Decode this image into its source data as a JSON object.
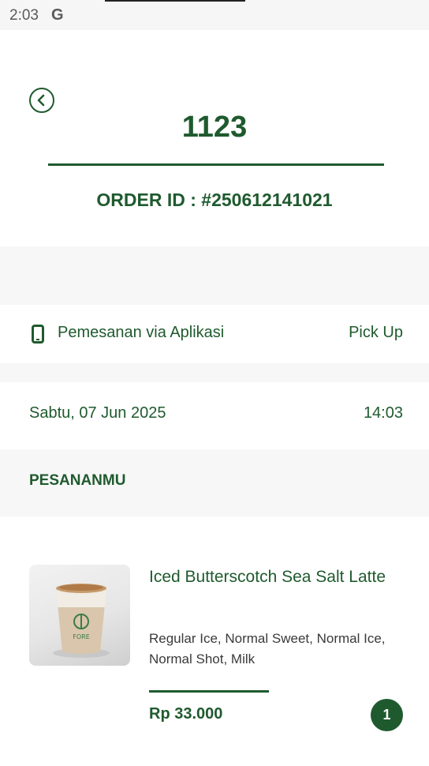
{
  "status_bar": {
    "time": "2:03",
    "google_icon": "G"
  },
  "header": {
    "back_icon": "chevron-left-circle",
    "queue_number": "1123",
    "order_id": "ORDER ID : #250612141021"
  },
  "order_info": {
    "channel_icon": "smartphone",
    "channel_label": "Pemesanan via Aplikasi",
    "pickup_type": "Pick Up",
    "date": "Sabtu, 07 Jun 2025",
    "time": "14:03"
  },
  "section": {
    "title": "PESANANMU"
  },
  "items": [
    {
      "name": "Iced Butterscotch Sea Salt Latte",
      "options": "Regular Ice, Normal Sweet, Normal Ice, Normal Shot, Milk",
      "price": "Rp 33.000",
      "quantity": "1",
      "cup_logo_text": "FORE"
    }
  ],
  "colors": {
    "primary": "#1f5a2e",
    "background": "#ffffff",
    "band": "#f7f7f7"
  }
}
